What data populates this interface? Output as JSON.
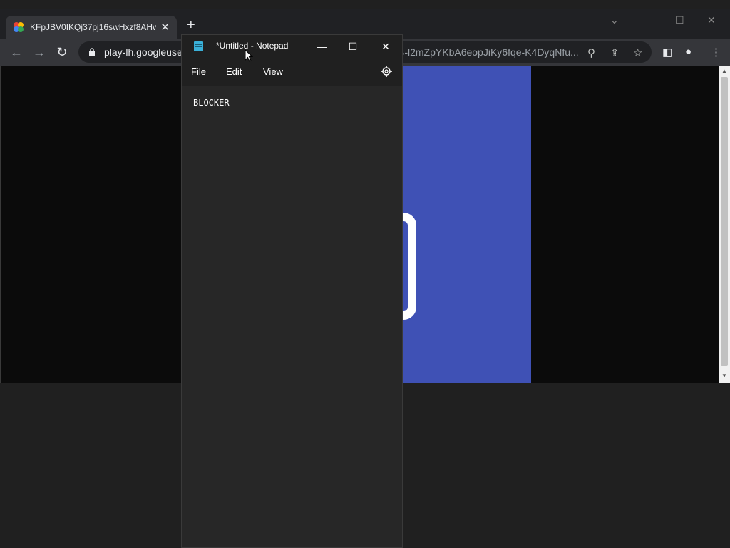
{
  "browser": {
    "tab_title": "KFpJBV0IKQj37pj16swHxzf8AHwl",
    "new_tab": "+",
    "url_host": "play-lh.googleuse",
    "url_rest": "B-l2mZpYKbA6eopJiKy6fqe-K4DyqNfu..."
  },
  "notepad": {
    "title": "*Untitled - Notepad",
    "menu": [
      "File",
      "Edit",
      "View"
    ],
    "content": "BLOCKER"
  },
  "colors": {
    "accent_blue": "#3f51b5",
    "notepad_bg": "#272727"
  },
  "icons": [
    "chrome-favicon",
    "close-icon",
    "back-icon",
    "forward-icon",
    "reload-icon",
    "lock-icon",
    "zoom-icon",
    "share-icon",
    "star-icon",
    "sidepanel-icon",
    "profile-icon",
    "more-icon",
    "notepad-icon",
    "minimize-icon",
    "maximize-icon",
    "gear-icon"
  ]
}
